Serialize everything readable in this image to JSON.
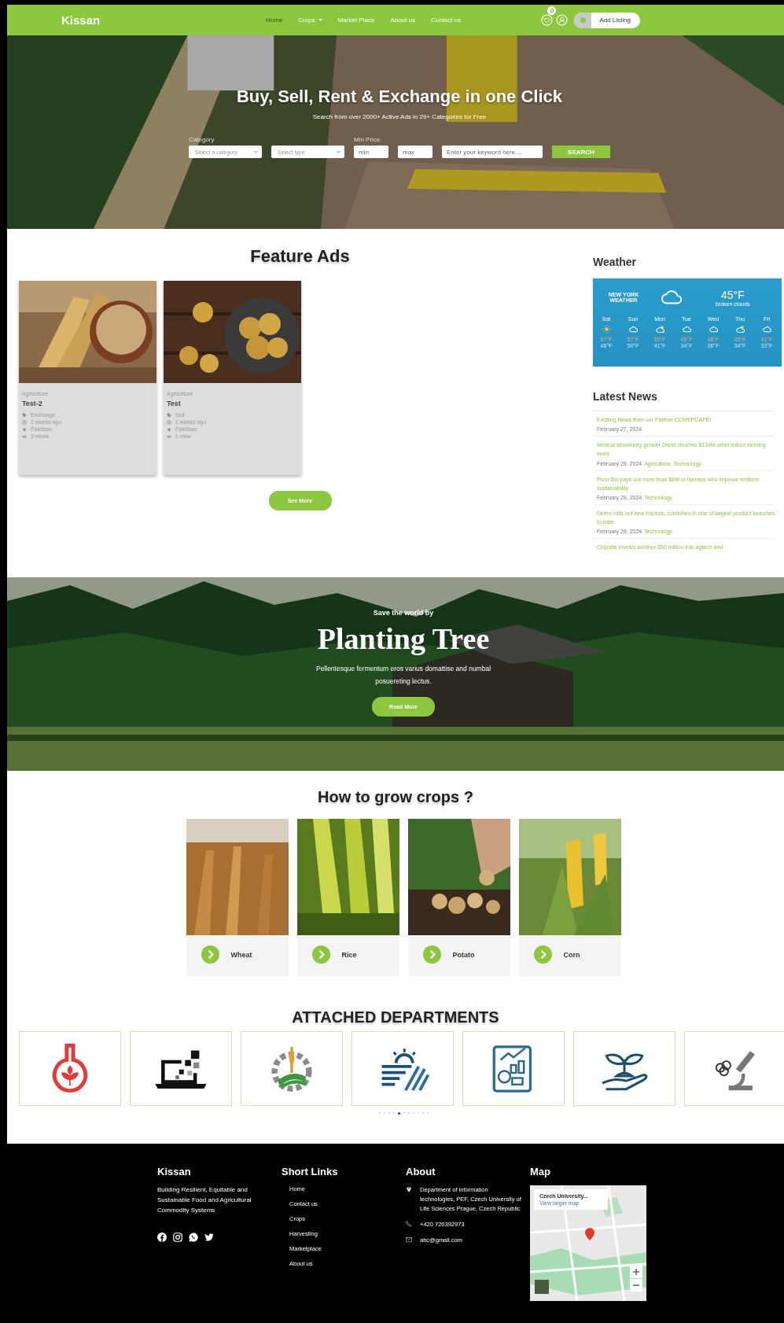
{
  "nav": {
    "logo": "Kissan",
    "links": [
      {
        "label": "Home",
        "selected": true,
        "dropdown": false
      },
      {
        "label": "Crops",
        "selected": false,
        "dropdown": true
      },
      {
        "label": "Market Place",
        "selected": false,
        "dropdown": false
      },
      {
        "label": "About us",
        "selected": false,
        "dropdown": false
      },
      {
        "label": "Contact us",
        "selected": false,
        "dropdown": false
      }
    ],
    "wishlist_count": "0",
    "add_listing": "Add Listing"
  },
  "hero": {
    "title": "Buy, Sell, Rent & Exchange in one Click",
    "subtitle": "Search from over 2000+ Active Ads in 29+ Categories for Free",
    "filters": [
      {
        "kind": "select",
        "label": "Category",
        "placeholder": "Select a category"
      },
      {
        "kind": "select",
        "placeholder": "Select type"
      },
      {
        "kind": "input",
        "label": "Min Price",
        "placeholder": "min"
      },
      {
        "kind": "input",
        "placeholder": "max"
      },
      {
        "kind": "input",
        "placeholder": "Enter your keyword here ..."
      }
    ],
    "search_button": "SEARCH"
  },
  "feature_ads": {
    "title": "Feature Ads",
    "ads": [
      {
        "category": "Agriculture",
        "title": "Test-2",
        "type": "Exchange",
        "time": "2 weeks ago",
        "location": "Pakistan",
        "views": "3 views"
      },
      {
        "category": "Agriculture",
        "title": "Test",
        "type": "Sell",
        "time": "2 weeks ago",
        "location": "Pakistan",
        "views": "1 view"
      }
    ],
    "see_more": "See More"
  },
  "weather": {
    "title": "Weather",
    "city": "NEW YORK WEATHER",
    "temp": "45°F",
    "condition": "broken clouds",
    "days": [
      {
        "day": "Sat",
        "kind": "sun",
        "high": "57°F",
        "low": "45°F"
      },
      {
        "day": "Sun",
        "kind": "cloud",
        "high": "57°F",
        "low": "50°F"
      },
      {
        "day": "Mon",
        "kind": "partly",
        "high": "50°F",
        "low": "41°F"
      },
      {
        "day": "Tue",
        "kind": "cloud",
        "high": "45°F",
        "low": "34°F"
      },
      {
        "day": "Wed",
        "kind": "cloud",
        "high": "48°F",
        "low": "36°F"
      },
      {
        "day": "Thu",
        "kind": "partly",
        "high": "45°F",
        "low": "34°F"
      },
      {
        "day": "Fri",
        "kind": "cloud",
        "high": "41°F",
        "low": "33°F"
      }
    ]
  },
  "news": {
    "title": "Latest News",
    "items": [
      {
        "title": "Exciting News from our Partner COMEPCAFE!",
        "date": "February 27, 2024"
      },
      {
        "title": "Vertical strawberry grower Oishii clinches $134M amid indoor farming woes",
        "date": "February 29, 2024",
        "tags": "Agriculture, Technology"
      },
      {
        "title": "Pivot Bio pays out more than $6M to farmers who improve fertilizer sustainability",
        "date": "February 29, 2024",
        "tags": "Technology"
      },
      {
        "title": "Deere rolls out new tractors, combines in one of largest product launches to date",
        "date": "February 29, 2024",
        "tags": "Technology"
      },
      {
        "title": "Chipotle invests another $50 million into agtech and"
      }
    ]
  },
  "planting": {
    "kicker": "Save the world by",
    "title": "Planting Tree",
    "text": "Pellentesque fermentum eros varius domattise and numbal posuereting lectus.",
    "button": "Read More"
  },
  "grow": {
    "title": "How to grow crops ?",
    "crops": [
      {
        "name": "Wheat"
      },
      {
        "name": "Rice"
      },
      {
        "name": "Potato"
      },
      {
        "name": "Corn"
      }
    ]
  },
  "departments": {
    "title": "ATTACHED DEPARTMENTS",
    "dots": [
      {
        "selected": false
      },
      {
        "selected": false
      },
      {
        "selected": false
      },
      {
        "selected": false
      },
      {
        "selected": true
      },
      {
        "selected": false
      },
      {
        "selected": false
      },
      {
        "selected": false
      },
      {
        "selected": false
      },
      {
        "selected": false
      },
      {
        "selected": false
      }
    ]
  },
  "footer": {
    "brand": {
      "title": "Kissan",
      "text": "Building Resilient, Equitable and Sustainable Food and Agricultural Commodity Systems"
    },
    "links": {
      "title": "Short Links",
      "items": [
        "Home",
        "Contact us",
        "Crops",
        "Harvesting",
        "Marketplace",
        "About us"
      ]
    },
    "about": {
      "title": "About",
      "address": "Department of information technologies, PEF, Czech University of Life Sciences Prague, Czech Republic",
      "phone": "+420 720392973",
      "email": "abc@gmail.com"
    },
    "map": {
      "title": "Map",
      "place": "Czech University...",
      "link": "View larger map"
    }
  }
}
